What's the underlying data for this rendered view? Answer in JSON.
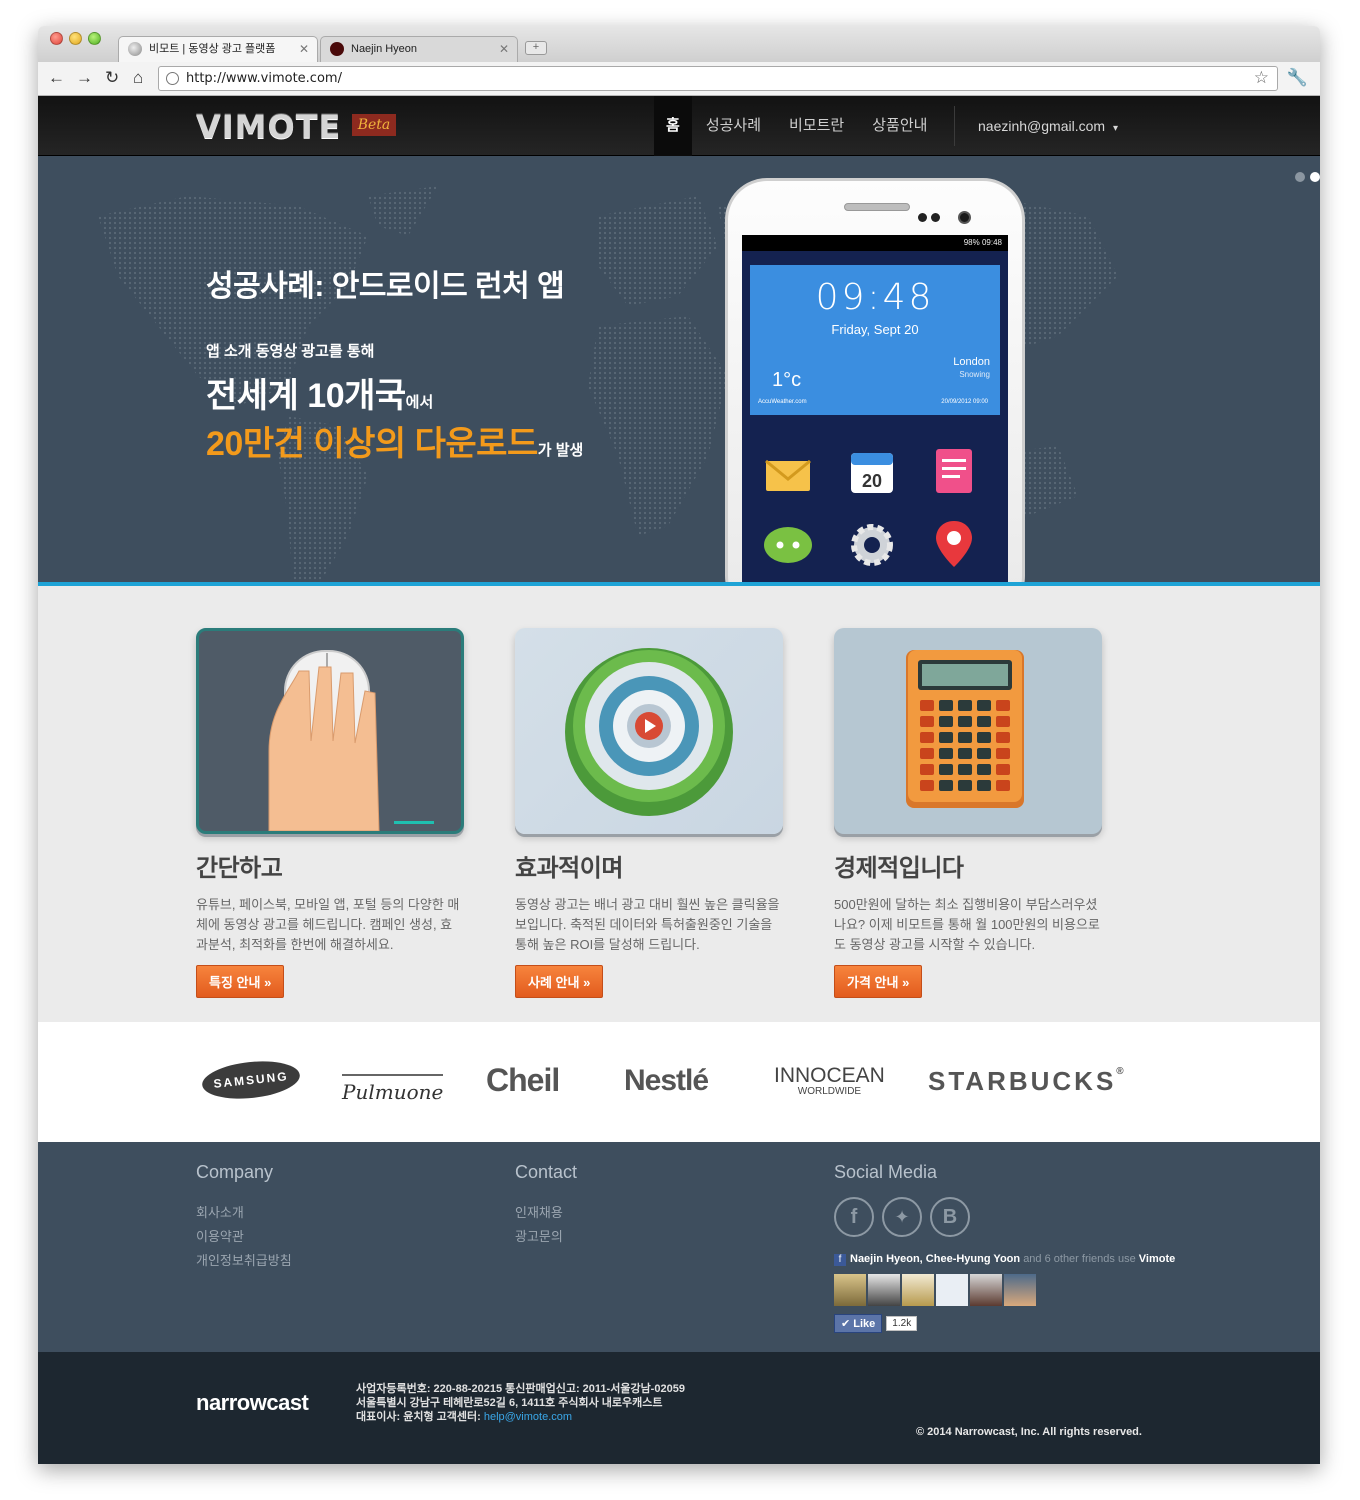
{
  "browser": {
    "tabs": [
      {
        "title": "비모트 | 동영상 광고 플랫폼",
        "active": true
      },
      {
        "title": "Naejin Hyeon",
        "active": false
      }
    ],
    "tab_close": "✕",
    "new_tab": "+",
    "url": "http://www.vimote.com/"
  },
  "nav": {
    "logo": "VIMOTE",
    "beta": "Beta",
    "items": [
      "홈",
      "성공사례",
      "비모트란",
      "상품안내"
    ],
    "user": "naezinh@gmail.com",
    "user_caret": "▾"
  },
  "hero": {
    "title": "성공사례: 안드로이드 런처 앱",
    "sub": "앱 소개 동영상 광고를 통해",
    "line1_big": "전세계 10개국",
    "line1_small": "에서",
    "line2_big": "20만건 이상의 다운로드",
    "line2_small": "가 발생",
    "slide_count": 2,
    "active_slide": 2,
    "phone": {
      "status": "98% 09:48",
      "time": "09:48",
      "date": "Friday, Sept 20",
      "city": "London",
      "condition": "Snowing",
      "temp": "1°c",
      "brand": "AccuWeather.com",
      "stamp": "20/09/2012  09:00",
      "calendar_day": "20",
      "apps": [
        "mail-icon",
        "calendar-icon",
        "notes-icon",
        "chat-icon",
        "settings-icon",
        "map-pin-icon"
      ]
    }
  },
  "features": [
    {
      "title": "간단하고",
      "desc": "유튜브, 페이스북, 모바일 앱, 포털 등의 다양한 매체에 동영상 광고를 헤드립니다. 캠페인 생성, 효과분석, 최적화를 한번에 해결하세요.",
      "button": "특징 안내 »",
      "icon": "mouse-hand-icon"
    },
    {
      "title": "효과적이며",
      "desc": "동영상 광고는 배너 광고 대비 훨씬 높은 클릭율을 보입니다. 축적된 데이터와 특허출원중인 기술을 통해 높은 ROI를 달성해 드립니다.",
      "button": "사례 안내 »",
      "icon": "target-play-icon"
    },
    {
      "title": "경제적입니다",
      "desc": "500만원에 달하는 최소 집행비용이 부담스러우셨나요? 이제 비모트를 통해 월 100만원의 비용으로도 동영상 광고를 시작할 수 있습니다.",
      "button": "가격 안내 »",
      "icon": "calculator-icon"
    }
  ],
  "clients": [
    "SAMSUNG",
    "Pulmuone",
    "Cheil",
    "Nestlé",
    "INNOCEAN",
    "WORLDWIDE",
    "STARBUCKS",
    "®"
  ],
  "footer": {
    "company": {
      "heading": "Company",
      "links": [
        "회사소개",
        "이용약관",
        "개인정보취급방침"
      ]
    },
    "contact": {
      "heading": "Contact",
      "links": [
        "인재채용",
        "광고문의"
      ]
    },
    "social": {
      "heading": "Social Media",
      "icons": [
        "facebook-icon",
        "twitter-icon",
        "blogger-icon"
      ],
      "fb_friends": "Naejin Hyeon, Chee-Hyung Yoon",
      "fb_rest": "and 6 other friends use",
      "fb_app": "Vimote",
      "fb_badge": "f",
      "like_label": "Like",
      "like_count": "1.2k"
    }
  },
  "bottom": {
    "logo": "narrowcast",
    "reg": "사업자등록번호: 220-88-20215 통신판매업신고: 2011-서울강남-02059",
    "address": "서울특별시 강남구 테헤란로52길 6, 1411호 주식회사 내로우캐스트",
    "ceo": "대표이사: 윤치형 고객센터:",
    "email": "help@vimote.com",
    "copyright": "© 2014 Narrowcast, Inc. All rights reserved."
  }
}
